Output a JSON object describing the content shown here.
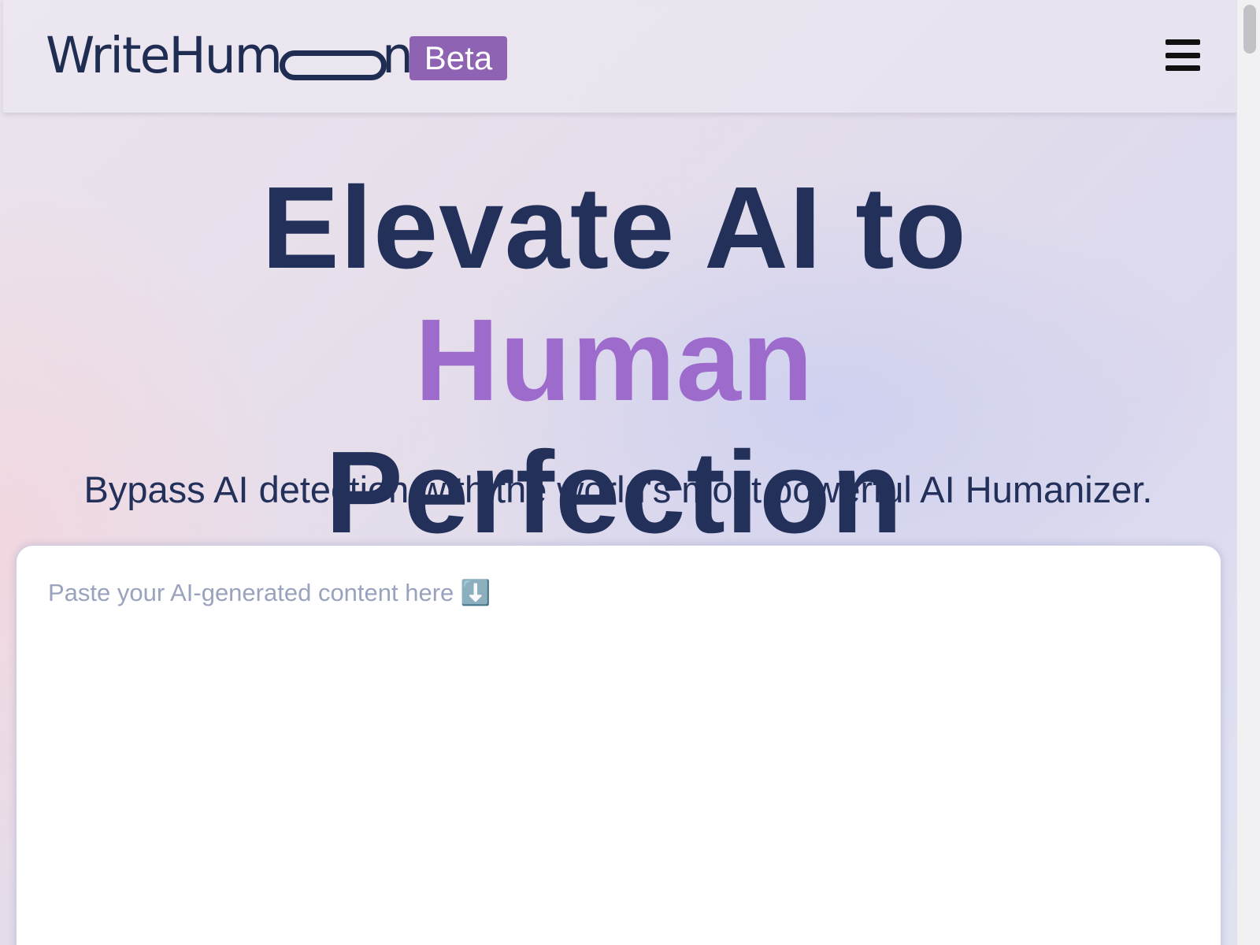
{
  "header": {
    "logo_text": "WriteHum",
    "logo_text_end": "n",
    "badge": "Beta",
    "menu_icon": "hamburger-menu-icon"
  },
  "hero": {
    "headline_part1": "Elevate AI to ",
    "headline_accent": "Human",
    "headline_part2": "Perfection",
    "subheadline": "Bypass AI detection with the world's most powerful AI Humanizer."
  },
  "editor": {
    "placeholder": "Paste your AI-generated content here ⬇️",
    "value": ""
  },
  "colors": {
    "brand_navy": "#22305a",
    "accent_purple": "#9d6bcb",
    "badge_purple": "#8e63b3"
  }
}
